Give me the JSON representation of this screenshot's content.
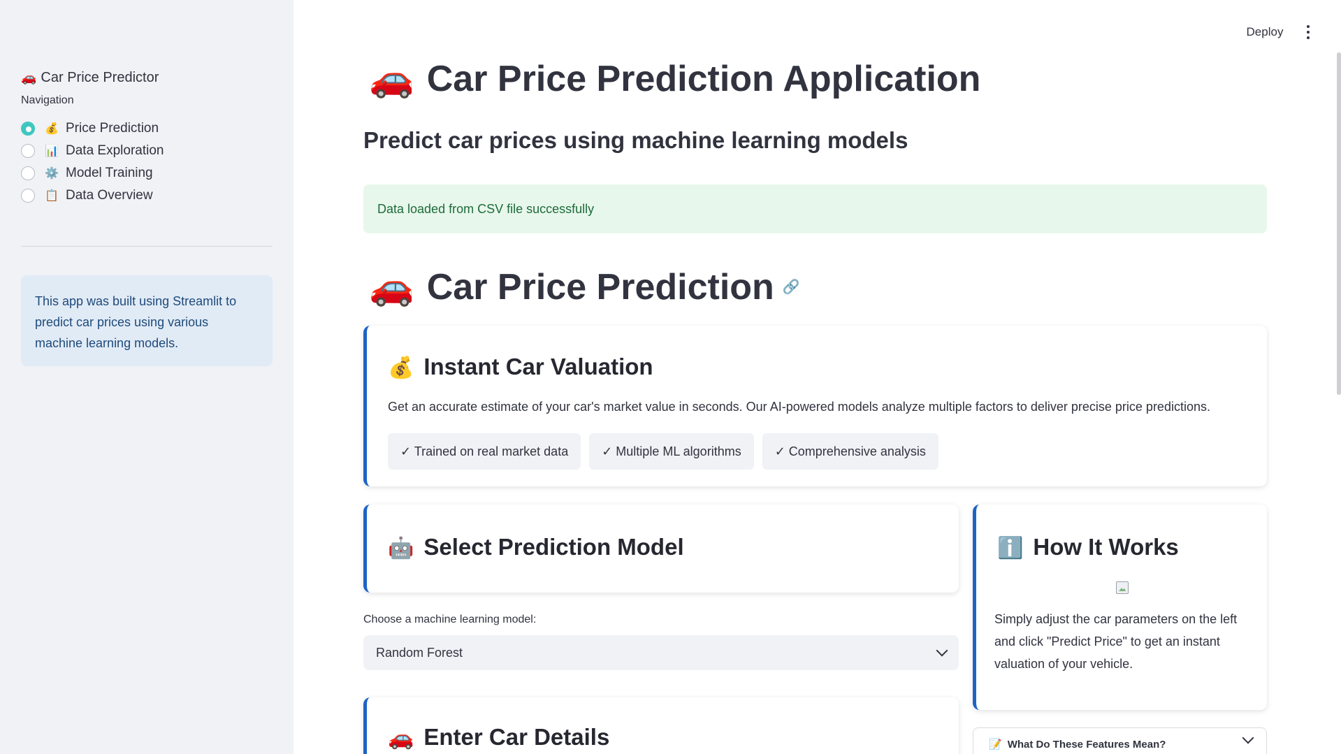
{
  "sidebar": {
    "app_icon": "🚗",
    "app_title": "Car Price Predictor",
    "nav_label": "Navigation",
    "nav_items": [
      {
        "icon": "💰",
        "label": "Price Prediction",
        "selected": true
      },
      {
        "icon": "📊",
        "label": "Data Exploration",
        "selected": false
      },
      {
        "icon": "⚙️",
        "label": "Model Training",
        "selected": false
      },
      {
        "icon": "📋",
        "label": "Data Overview",
        "selected": false
      }
    ],
    "info_text": "This app was built using Streamlit to predict car prices using various machine learning models."
  },
  "header": {
    "deploy_label": "Deploy",
    "menu_icon": "more-vertical-icon"
  },
  "main": {
    "title_icon": "🚗",
    "title": "Car Price Prediction Application",
    "subtitle": "Predict car prices using machine learning models",
    "success_message": "Data loaded from CSV file successfully",
    "section_icon": "🚗",
    "section_title": "Car Price Prediction",
    "link_icon": "🔗",
    "valuation": {
      "icon": "💰",
      "title": "Instant Car Valuation",
      "text": "Get an accurate estimate of your car's market value in seconds. Our AI-powered models analyze multiple factors to deliver precise price predictions.",
      "pills": [
        "✓ Trained on real market data",
        "✓ Multiple ML algorithms",
        "✓ Comprehensive analysis"
      ]
    },
    "model_card": {
      "icon": "🤖",
      "title": "Select Prediction Model"
    },
    "model_select": {
      "label": "Choose a machine learning model:",
      "value": "Random Forest"
    },
    "details_card": {
      "icon": "🚗",
      "title": "Enter Car Details"
    },
    "how_card": {
      "icon": "ℹ️",
      "title": "How It Works",
      "text": "Simply adjust the car parameters on the left and click \"Predict Price\" to get an instant valuation of your vehicle."
    },
    "features_expander": {
      "icon": "📝",
      "label": "What Do These Features Mean?"
    }
  },
  "colors": {
    "accent": "#1c63c6",
    "radio_selected": "#3fc7c0",
    "success_bg": "#e8f7ec",
    "info_bg": "#e1ebf6"
  }
}
